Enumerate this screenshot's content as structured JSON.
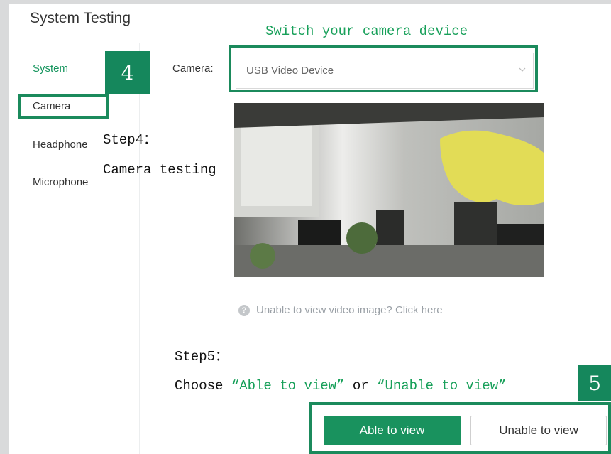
{
  "window": {
    "title": "System Testing"
  },
  "sidebar": {
    "items": [
      {
        "label": "System",
        "active": true
      },
      {
        "label": "Camera",
        "active": false
      },
      {
        "label": "Headphone",
        "active": false
      },
      {
        "label": "Microphone",
        "active": false
      }
    ]
  },
  "camera": {
    "label": "Camera:",
    "selected_device": "USB Video Device",
    "help_text": "Unable to view video image? Click here",
    "help_icon": "question-circle-icon"
  },
  "annotations": {
    "switch_caption": "Switch your camera device",
    "step4_title": "Step4：",
    "step4_desc": "Camera testing",
    "step5_title": "Step5：",
    "step5_prefix": "Choose ",
    "step5_option1": "“Able to view”",
    "step5_or": " or ",
    "step5_option2": "“Unable to view”",
    "badge4": "4",
    "badge5": "5"
  },
  "buttons": {
    "able": "Able to view",
    "unable": "Unable to view"
  },
  "colors": {
    "accent": "#19925e",
    "annotation_box": "#1b8a5c",
    "badge": "#15875c",
    "active_nav": "#16955e"
  }
}
